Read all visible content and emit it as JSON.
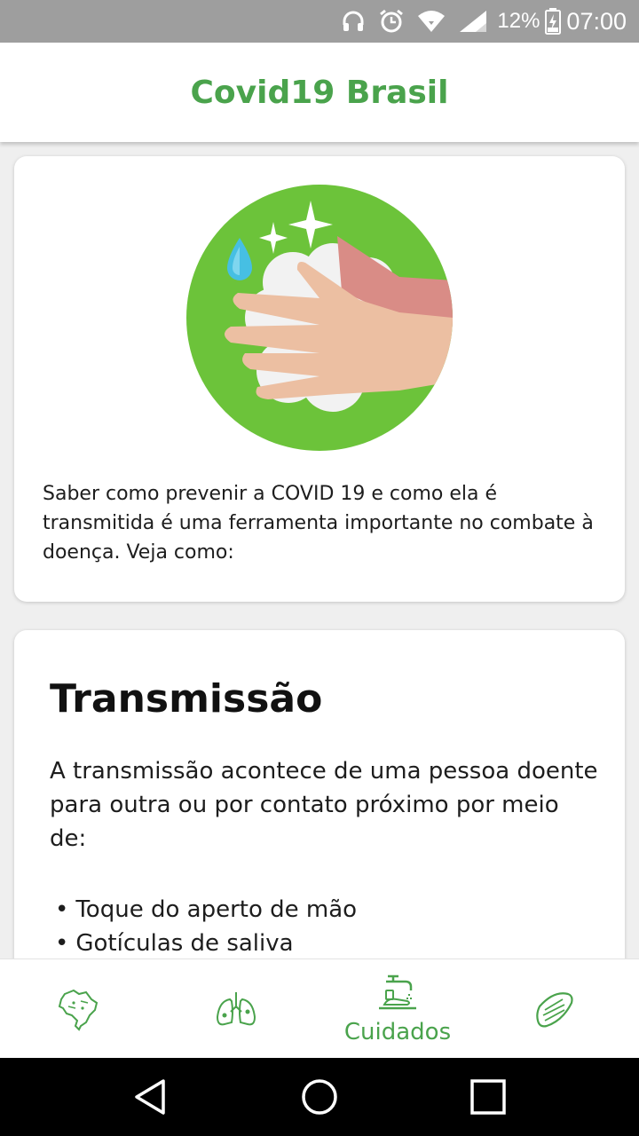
{
  "status_bar": {
    "battery_percent": "12%",
    "time": "07:00",
    "icons": [
      "headphones-icon",
      "alarm-icon",
      "wifi-icon",
      "signal-icon",
      "battery-charging-icon"
    ]
  },
  "app_bar": {
    "title": "Covid19 Brasil"
  },
  "intro_card": {
    "text": "Saber como prevenir a COVID 19 e como ela é transmitida é uma ferramenta importante no combate à doença. Veja como:"
  },
  "transmission_card": {
    "title": "Transmissão",
    "paragraph": "A transmissão acontece de uma pessoa doente para outra ou por contato próximo por meio de:",
    "bullets": [
      "Toque do aperto de mão",
      "Gotículas de saliva"
    ]
  },
  "bottom_nav": {
    "items": [
      {
        "icon": "brazil-map-icon",
        "label": ""
      },
      {
        "icon": "lungs-icon",
        "label": ""
      },
      {
        "icon": "handwash-icon",
        "label": "Cuidados"
      },
      {
        "icon": "mask-icon",
        "label": ""
      }
    ],
    "active_index": 2
  },
  "colors": {
    "accent": "#4aa34c",
    "illustration_green": "#6cc33a"
  }
}
